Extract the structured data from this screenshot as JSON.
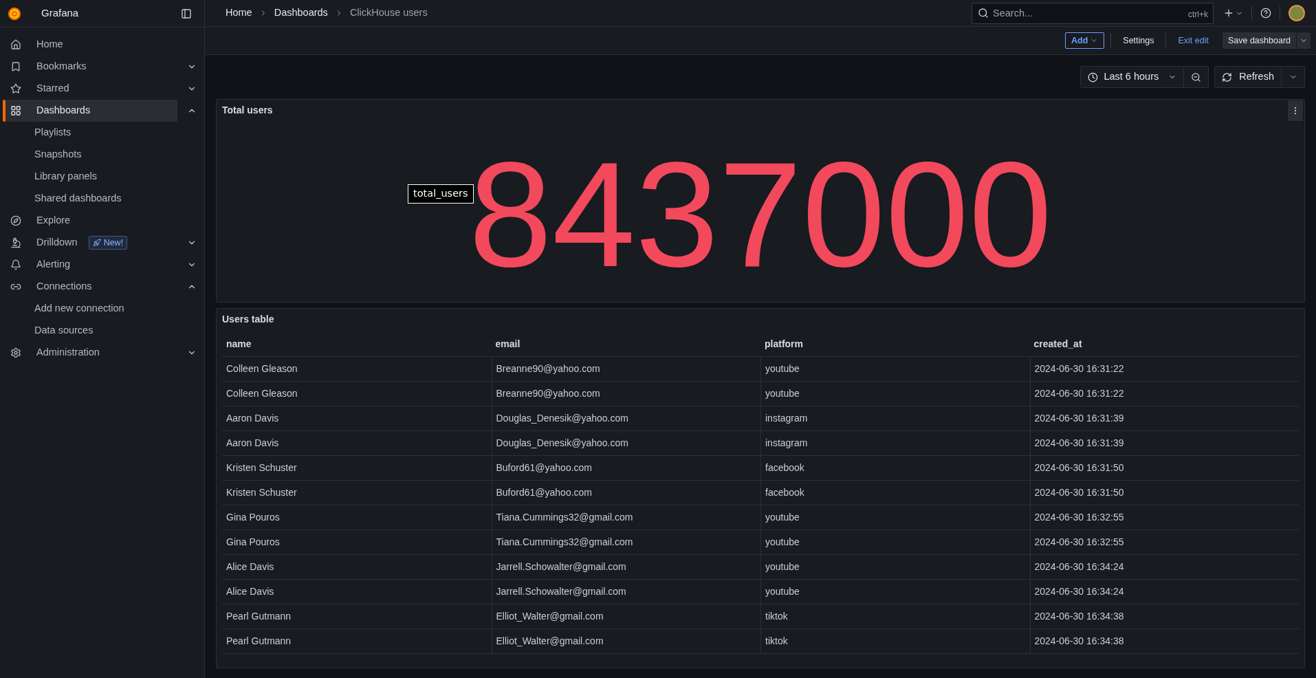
{
  "sidebar": {
    "brand": "Grafana",
    "items": [
      {
        "label": "Home",
        "selected": false
      },
      {
        "label": "Bookmarks",
        "selected": false,
        "expanded": false
      },
      {
        "label": "Starred",
        "selected": false,
        "expanded": false
      },
      {
        "label": "Dashboards",
        "selected": true,
        "expanded": true,
        "children": [
          {
            "label": "Playlists"
          },
          {
            "label": "Snapshots"
          },
          {
            "label": "Library panels"
          },
          {
            "label": "Shared dashboards"
          }
        ]
      },
      {
        "label": "Explore",
        "selected": false
      },
      {
        "label": "Drilldown",
        "selected": false,
        "expanded": false,
        "badge": "New!"
      },
      {
        "label": "Alerting",
        "selected": false,
        "expanded": false
      },
      {
        "label": "Connections",
        "selected": false,
        "expanded": true,
        "children": [
          {
            "label": "Add new connection"
          },
          {
            "label": "Data sources"
          }
        ]
      },
      {
        "label": "Administration",
        "selected": false,
        "expanded": false
      }
    ]
  },
  "breadcrumbs": [
    "Home",
    "Dashboards",
    "ClickHouse users"
  ],
  "search": {
    "placeholder": "Search...",
    "shortcut": "ctrl+k"
  },
  "edit_bar": {
    "add": "Add",
    "settings": "Settings",
    "exit": "Exit edit",
    "save": "Save dashboard"
  },
  "time_controls": {
    "range": "Last 6 hours",
    "refresh": "Refresh"
  },
  "stat_panel": {
    "title": "Total users",
    "value": "8437000",
    "tooltip": "total_users"
  },
  "table_panel": {
    "title": "Users table",
    "columns": [
      "name",
      "email",
      "platform",
      "created_at"
    ],
    "rows": [
      [
        "Colleen Gleason",
        "Breanne90@yahoo.com",
        "youtube",
        "2024-06-30 16:31:22"
      ],
      [
        "Colleen Gleason",
        "Breanne90@yahoo.com",
        "youtube",
        "2024-06-30 16:31:22"
      ],
      [
        "Aaron Davis",
        "Douglas_Denesik@yahoo.com",
        "instagram",
        "2024-06-30 16:31:39"
      ],
      [
        "Aaron Davis",
        "Douglas_Denesik@yahoo.com",
        "instagram",
        "2024-06-30 16:31:39"
      ],
      [
        "Kristen Schuster",
        "Buford61@yahoo.com",
        "facebook",
        "2024-06-30 16:31:50"
      ],
      [
        "Kristen Schuster",
        "Buford61@yahoo.com",
        "facebook",
        "2024-06-30 16:31:50"
      ],
      [
        "Gina Pouros",
        "Tiana.Cummings32@gmail.com",
        "youtube",
        "2024-06-30 16:32:55"
      ],
      [
        "Gina Pouros",
        "Tiana.Cummings32@gmail.com",
        "youtube",
        "2024-06-30 16:32:55"
      ],
      [
        "Alice Davis",
        "Jarrell.Schowalter@gmail.com",
        "youtube",
        "2024-06-30 16:34:24"
      ],
      [
        "Alice Davis",
        "Jarrell.Schowalter@gmail.com",
        "youtube",
        "2024-06-30 16:34:24"
      ],
      [
        "Pearl Gutmann",
        "Elliot_Walter@gmail.com",
        "tiktok",
        "2024-06-30 16:34:38"
      ],
      [
        "Pearl Gutmann",
        "Elliot_Walter@gmail.com",
        "tiktok",
        "2024-06-30 16:34:38"
      ]
    ]
  }
}
